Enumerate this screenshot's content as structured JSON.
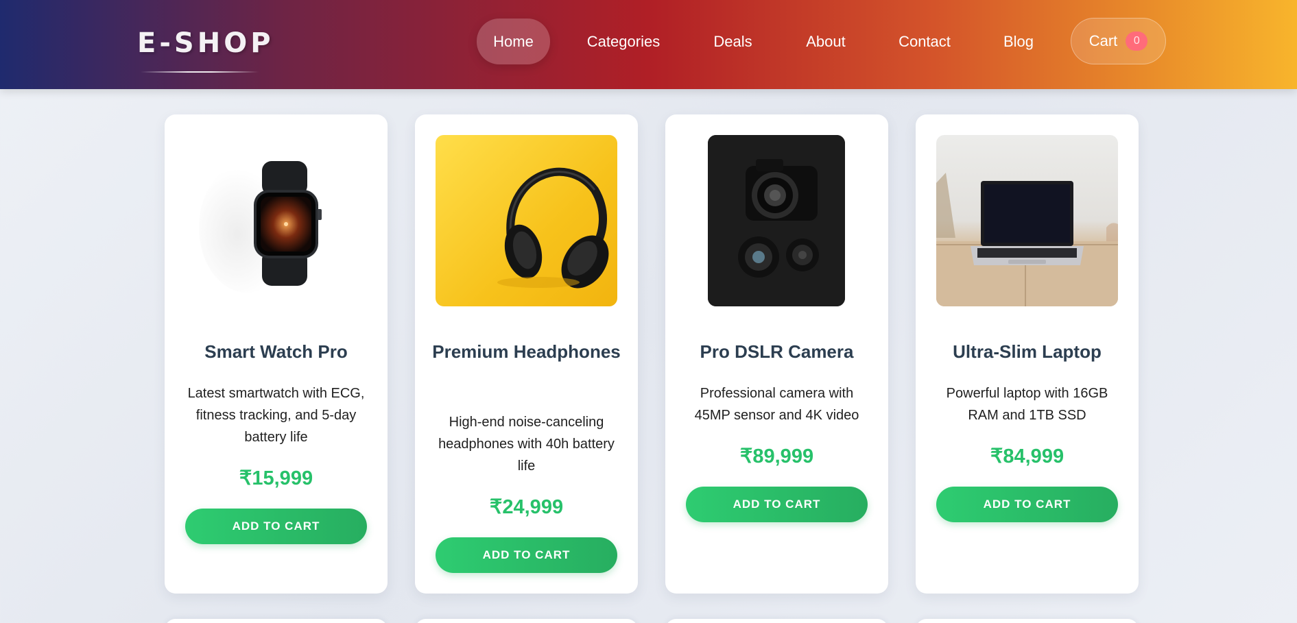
{
  "brand": {
    "logo": "E-SHOP"
  },
  "nav": {
    "items": [
      {
        "label": "Home",
        "active": true
      },
      {
        "label": "Categories",
        "active": false
      },
      {
        "label": "Deals",
        "active": false
      },
      {
        "label": "About",
        "active": false
      },
      {
        "label": "Contact",
        "active": false
      },
      {
        "label": "Blog",
        "active": false
      }
    ],
    "cart": {
      "label": "Cart",
      "count": "0"
    }
  },
  "products": [
    {
      "title": "Smart Watch Pro",
      "description": "Latest smartwatch with ECG, fitness tracking, and 5-day battery life",
      "price": "₹15,999",
      "button": "ADD TO CART",
      "image_icon": "smartwatch-image"
    },
    {
      "title": "Premium Headphones",
      "description": "High-end noise-canceling headphones with 40h battery life",
      "price": "₹24,999",
      "button": "ADD TO CART",
      "image_icon": "headphones-image"
    },
    {
      "title": "Pro DSLR Camera",
      "description": "Professional camera with 45MP sensor and 4K video",
      "price": "₹89,999",
      "button": "ADD TO CART",
      "image_icon": "camera-image"
    },
    {
      "title": "Ultra-Slim Laptop",
      "description": "Powerful laptop with 16GB RAM and 1TB SSD",
      "price": "₹84,999",
      "button": "ADD TO CART",
      "image_icon": "laptop-image"
    }
  ],
  "colors": {
    "accent_green": "#27c16a",
    "title_dark": "#2c3e50",
    "badge": "#ff6b7a"
  }
}
